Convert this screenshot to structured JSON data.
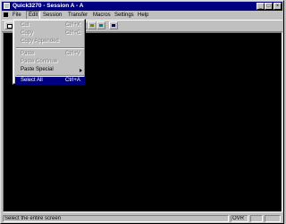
{
  "window": {
    "title": "Quick3270 - Session A - A"
  },
  "menubar": {
    "items": [
      "File",
      "Edit",
      "Session",
      "Transfer",
      "Macros",
      "Settings",
      "Help"
    ]
  },
  "edit_menu": {
    "items": [
      {
        "label": "Cut",
        "shortcut": "Ctrl+X",
        "enabled": false,
        "selected": false
      },
      {
        "label": "Copy",
        "shortcut": "Ctrl+C",
        "enabled": false,
        "selected": false
      },
      {
        "label": "Copy Appended",
        "shortcut": "",
        "enabled": false,
        "selected": false
      },
      {
        "separator": true
      },
      {
        "label": "Paste",
        "shortcut": "Ctrl+V",
        "enabled": false,
        "selected": false
      },
      {
        "label": "Paste Continue",
        "shortcut": "",
        "enabled": false,
        "selected": false
      },
      {
        "label": "Paste Special",
        "shortcut": "",
        "enabled": true,
        "selected": false,
        "submenu": true
      },
      {
        "separator": true
      },
      {
        "label": "Select All",
        "shortcut": "Ctrl+A",
        "enabled": true,
        "selected": true
      }
    ]
  },
  "statusbar": {
    "message": "Select the entire screen",
    "mode": "OVR"
  },
  "colors": {
    "titlebar": "#000080",
    "terminal_bg": "#000000",
    "chrome": "#c0c0c0",
    "highlight": "#000080"
  }
}
